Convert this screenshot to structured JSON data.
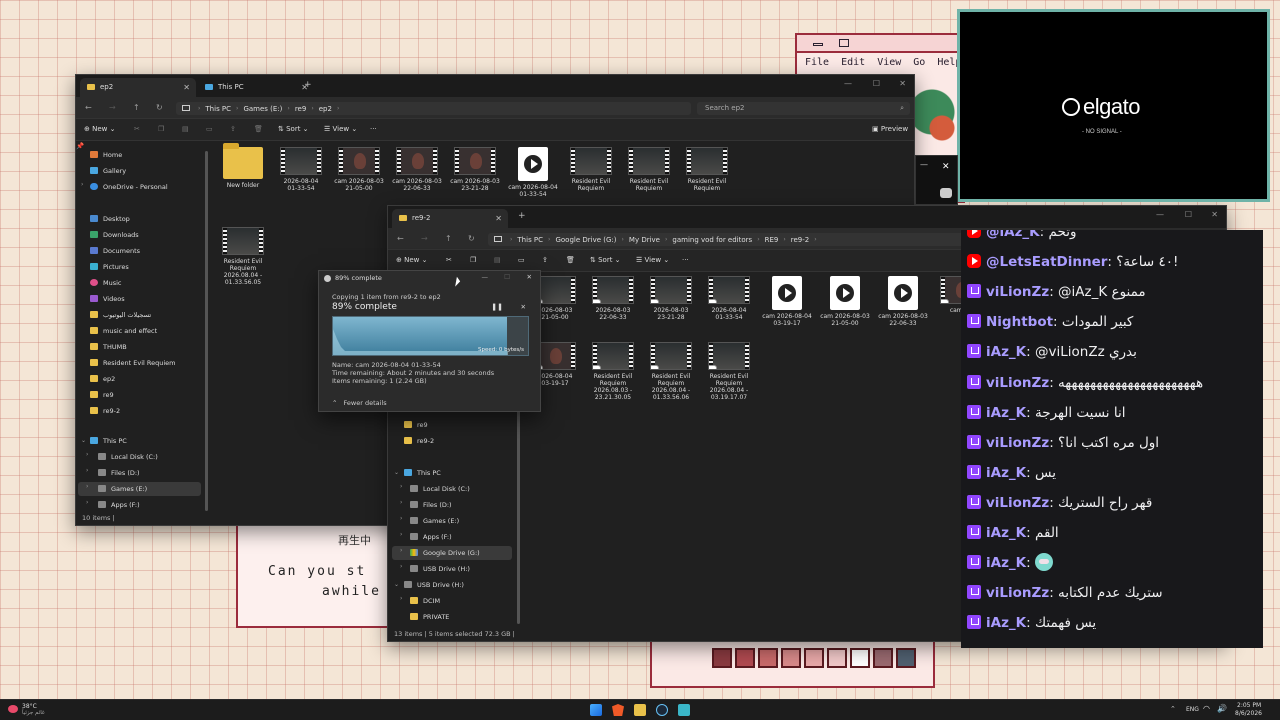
{
  "retro_top": {
    "menu": [
      "File",
      "Edit",
      "View",
      "Go",
      "Help"
    ]
  },
  "retro_bottom": {
    "jp_text": "再生中",
    "line1": "Can you st",
    "line2": "awhile"
  },
  "explorer1": {
    "tabs": [
      {
        "label": "ep2"
      },
      {
        "label": "This PC"
      }
    ],
    "breadcrumb": [
      "This PC",
      "Games (E:)",
      "re9",
      "ep2"
    ],
    "search_placeholder": "Search ep2",
    "cmd": {
      "new": "New",
      "sort": "Sort",
      "view": "View",
      "more": "···",
      "preview": "Preview"
    },
    "nav": [
      {
        "label": "Home"
      },
      {
        "label": "Gallery"
      },
      {
        "label": "OneDrive - Personal"
      },
      {
        "label": "Desktop"
      },
      {
        "label": "Downloads"
      },
      {
        "label": "Documents"
      },
      {
        "label": "Pictures"
      },
      {
        "label": "Music"
      },
      {
        "label": "Videos"
      },
      {
        "label": "تسجيلات اليوتيوب"
      },
      {
        "label": "music and effect"
      },
      {
        "label": "THUMB"
      },
      {
        "label": "Resident Evil Requiem"
      },
      {
        "label": "ep2"
      },
      {
        "label": "re9"
      },
      {
        "label": "re9-2"
      },
      {
        "label": "This PC"
      },
      {
        "label": "Local Disk (C:)"
      },
      {
        "label": "Files (D:)"
      },
      {
        "label": "Games (E:)"
      },
      {
        "label": "Apps (F:)"
      }
    ],
    "files": [
      {
        "name": "New folder",
        "kind": "folder"
      },
      {
        "name": "2026-08-04\n01-33-54",
        "kind": "dark"
      },
      {
        "name": "cam 2026-08-03\n21-05-00",
        "kind": "face"
      },
      {
        "name": "cam 2026-08-03\n22-06-33",
        "kind": "face"
      },
      {
        "name": "cam 2026-08-03\n23-21-28",
        "kind": "face"
      },
      {
        "name": "cam 2026-08-04\n01-33-54",
        "kind": "play"
      },
      {
        "name": "Resident Evil\nRequiem",
        "kind": "dark"
      },
      {
        "name": "Resident Evil\nRequiem",
        "kind": "dark"
      },
      {
        "name": "Resident Evil\nRequiem",
        "kind": "dark"
      },
      {
        "name": "Resident Evil\nRequiem\n2026.08.04 -\n01.33.56.05",
        "kind": "dark"
      }
    ],
    "status": "10 items  |"
  },
  "explorer2": {
    "tabs": [
      {
        "label": "re9-2"
      }
    ],
    "breadcrumb": [
      "This PC",
      "Google Drive (G:)",
      "My Drive",
      "gaming vod for editors",
      "RE9",
      "re9-2"
    ],
    "cmd": {
      "new": "New",
      "sort": "Sort",
      "view": "View",
      "more": "···"
    },
    "nav": [
      {
        "label": "re9"
      },
      {
        "label": "re9-2"
      },
      {
        "label": "This PC"
      },
      {
        "label": "Local Disk (C:)"
      },
      {
        "label": "Files (D:)"
      },
      {
        "label": "Games (E:)"
      },
      {
        "label": "Apps (F:)"
      },
      {
        "label": "Google Drive (G:)"
      },
      {
        "label": "USB Drive (H:)"
      },
      {
        "label": "USB Drive (H:)"
      },
      {
        "label": "DCIM"
      },
      {
        "label": "PRIVATE"
      }
    ],
    "files": [
      {
        "name": "2026-08-03\n21-05-00",
        "kind": "dark"
      },
      {
        "name": "2026-08-03\n22-06-33",
        "kind": "dark"
      },
      {
        "name": "2026-08-03\n23-21-28",
        "kind": "dark"
      },
      {
        "name": "2026-08-04\n01-33-54",
        "kind": "dark"
      },
      {
        "name": "cam 2026-08-04\n03-19-17",
        "kind": "play"
      },
      {
        "name": "cam 2026-08-03\n21-05-00",
        "kind": "play"
      },
      {
        "name": "cam 2026-08-03\n22-06-33",
        "kind": "play"
      },
      {
        "name": "cam 20",
        "kind": "face"
      },
      {
        "name": "2026-08-04\n03-19-17",
        "kind": "face"
      },
      {
        "name": "Resident Evil\nRequiem\n2026.08.03 -\n23.21.30.05",
        "kind": "dark"
      },
      {
        "name": "Resident Evil\nRequiem\n2026.08.04 -\n01.33.56.06",
        "kind": "dark"
      },
      {
        "name": "Resident Evil\nRequiem\n2026.08.04 -\n03.19.17.07",
        "kind": "dark"
      }
    ],
    "status": "13 items  |  5 items selected  72.3 GB  |"
  },
  "copy_dialog": {
    "title": "89% complete",
    "copying": "Copying 1 item from re9-2 to ep2",
    "heading": "89% complete",
    "progress": 0.89,
    "speed": "Speed: 0 bytes/s",
    "name": "Name:  cam 2026-08-04 01-33-54",
    "time_remaining": "Time remaining:  About 2 minutes and 30 seconds",
    "items_remaining": "Items remaining:  1 (2.24 GB)",
    "fewer_details": "Fewer details"
  },
  "elgato": {
    "logo": "elgato",
    "status": "- NO SIGNAL -"
  },
  "chat": {
    "messages": [
      {
        "platform": "youtube",
        "user": "@iAz_K",
        "color": "#a99cff",
        "text": "وتخم"
      },
      {
        "platform": "youtube",
        "user": "@LetsEatDinner",
        "color": "#a99cff",
        "text": "٤٠ ساعة؟!"
      },
      {
        "platform": "twitch",
        "user": "viLionZz",
        "color": "#a99cff",
        "text": "@iAz_K ممنوع"
      },
      {
        "platform": "twitch",
        "user": "Nightbot",
        "color": "#a99cff",
        "text": "كبير المودات"
      },
      {
        "platform": "twitch",
        "user": "iAz_K",
        "color": "#a99cff",
        "text": "@viLionZz بدري"
      },
      {
        "platform": "twitch",
        "user": "viLionZz",
        "color": "#a99cff",
        "text": "ههههههههههههههههههههههه"
      },
      {
        "platform": "twitch",
        "user": "iAz_K",
        "color": "#a99cff",
        "text": "انا نسيت الهرجة"
      },
      {
        "platform": "twitch",
        "user": "viLionZz",
        "color": "#a99cff",
        "text": "اول مره اكتب انا؟"
      },
      {
        "platform": "twitch",
        "user": "iAz_K",
        "color": "#a99cff",
        "text": "يس"
      },
      {
        "platform": "twitch",
        "user": "viLionZz",
        "color": "#a99cff",
        "text": "قهر راح الستريك"
      },
      {
        "platform": "twitch",
        "user": "iAz_K",
        "color": "#a99cff",
        "text": "القم"
      },
      {
        "platform": "twitch",
        "user": "iAz_K",
        "color": "#a99cff",
        "text": "",
        "emote": true
      },
      {
        "platform": "twitch",
        "user": "viLionZz",
        "color": "#a99cff",
        "text": "ستريك عدم الكتابه"
      },
      {
        "platform": "twitch",
        "user": "iAz_K",
        "color": "#a99cff",
        "text": "يس فهمتك"
      }
    ]
  },
  "taskbar": {
    "weather_temp": "38°C",
    "weather_desc": "غائم جزئياً",
    "lang": "ENG",
    "time": "2:05 PM",
    "date": "8/6/2026"
  },
  "colors": {
    "twitch": "#9146ff",
    "youtube": "#ff0000",
    "progress": "#7fb6cf",
    "elgato_border": "#6fb3a8"
  }
}
